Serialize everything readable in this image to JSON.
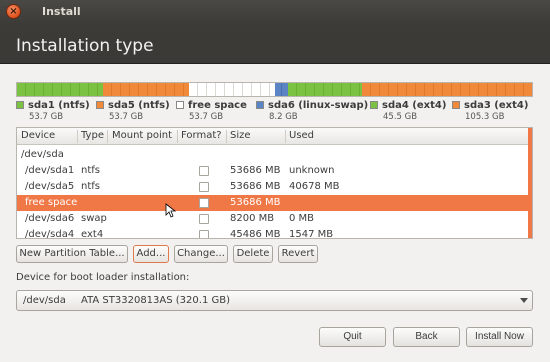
{
  "window": {
    "title": "Install",
    "close_glyph": "×"
  },
  "header": {
    "title": "Installation type"
  },
  "partition_bar": {
    "segments": [
      {
        "id": "sda1",
        "color": "green",
        "fraction": 0.167
      },
      {
        "id": "sda5",
        "color": "orange",
        "fraction": 0.167
      },
      {
        "id": "free",
        "color": "white",
        "fraction": 0.167
      },
      {
        "id": "sda6",
        "color": "blue",
        "fraction": 0.026
      },
      {
        "id": "sda4",
        "color": "green",
        "fraction": 0.142
      },
      {
        "id": "sda3",
        "color": "orange",
        "fraction": 0.331
      }
    ]
  },
  "legend": [
    {
      "name": "sda1 (ntfs)",
      "size": "53.7 GB",
      "color": "#7cc242"
    },
    {
      "name": "sda5 (ntfs)",
      "size": "53.7 GB",
      "color": "#f08a3a"
    },
    {
      "name": "free space",
      "size": "53.7 GB",
      "color": "#ffffff"
    },
    {
      "name": "sda6 (linux-swap)",
      "size": "8.2 GB",
      "color": "#5b84c4"
    },
    {
      "name": "sda4 (ext4)",
      "size": "45.5 GB",
      "color": "#7cc242"
    },
    {
      "name": "sda3 (ext4)",
      "size": "105.3 GB",
      "color": "#f08a3a"
    }
  ],
  "table": {
    "columns": [
      "Device",
      "Type",
      "Mount point",
      "Format?",
      "Size",
      "Used"
    ],
    "rows": [
      {
        "device": "/dev/sda",
        "type": "",
        "mount": "",
        "format": false,
        "show_cb": false,
        "size": "",
        "used": "",
        "indent": false,
        "selected": false
      },
      {
        "device": "/dev/sda1",
        "type": "ntfs",
        "mount": "",
        "format": false,
        "show_cb": true,
        "size": "53686 MB",
        "used": "unknown",
        "indent": true,
        "selected": false
      },
      {
        "device": "/dev/sda5",
        "type": "ntfs",
        "mount": "",
        "format": false,
        "show_cb": true,
        "size": "53686 MB",
        "used": "40678 MB",
        "indent": true,
        "selected": false
      },
      {
        "device": "free space",
        "type": "",
        "mount": "",
        "format": false,
        "show_cb": true,
        "size": "53686 MB",
        "used": "",
        "indent": true,
        "selected": true
      },
      {
        "device": "/dev/sda6",
        "type": "swap",
        "mount": "",
        "format": false,
        "show_cb": true,
        "size": "8200 MB",
        "used": "0 MB",
        "indent": true,
        "selected": false
      },
      {
        "device": "/dev/sda4",
        "type": "ext4",
        "mount": "",
        "format": false,
        "show_cb": true,
        "size": "45486 MB",
        "used": "1547 MB",
        "indent": true,
        "selected": false
      }
    ]
  },
  "partition_buttons": {
    "new_table": "New Partition Table...",
    "add": "Add...",
    "change": "Change...",
    "delete": "Delete",
    "revert": "Revert"
  },
  "bootloader": {
    "label": "Device for boot loader installation:",
    "device": "/dev/sda",
    "description": "ATA ST3320813AS (320.1 GB)"
  },
  "footer_buttons": {
    "quit": "Quit",
    "back": "Back",
    "install": "Install Now"
  }
}
